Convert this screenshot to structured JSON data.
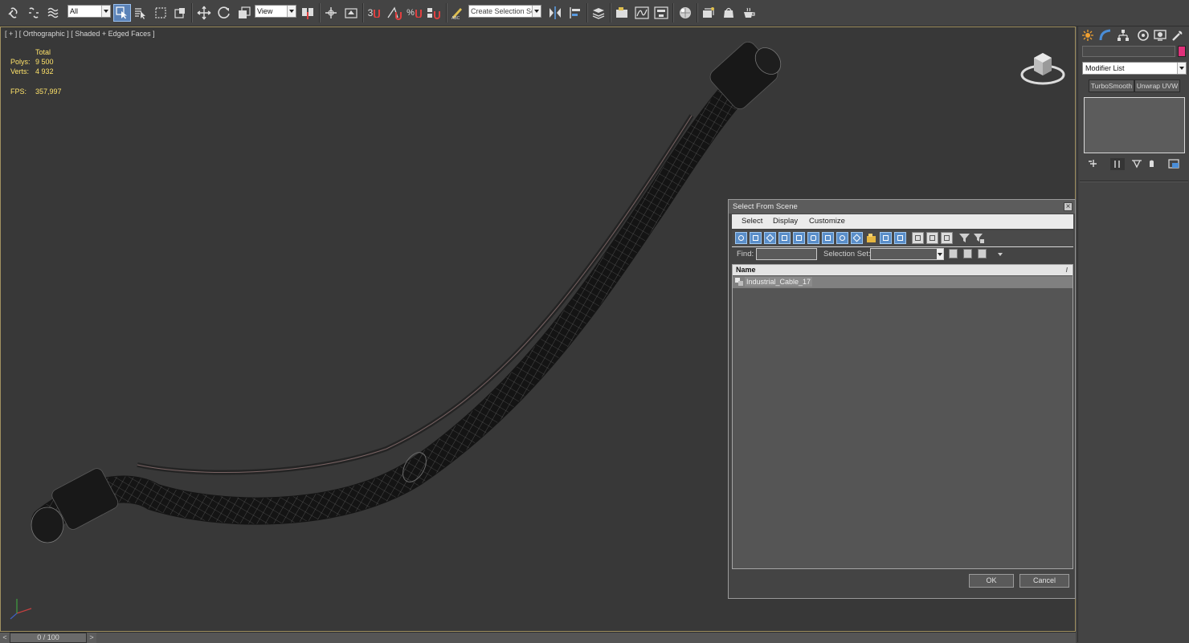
{
  "toolbar": {
    "filter_select": "All",
    "coord_select": "View",
    "snap_3d_label": "3",
    "snap_angle_label": "%",
    "named_selection_set": "Create Selection Se"
  },
  "viewport": {
    "label": "[ + ] [ Orthographic ] [ Shaded + Edged Faces ]",
    "stats": {
      "total_label": "Total",
      "polys_label": "Polys:",
      "polys_value": "9 500",
      "verts_label": "Verts:",
      "verts_value": "4 932",
      "fps_label": "FPS:",
      "fps_value": "357,997"
    }
  },
  "command_panel": {
    "object_name": "",
    "object_color": "#e0317a",
    "modifier_list": "Modifier List",
    "preset_buttons": [
      "TurboSmooth",
      "Unwrap UVW"
    ]
  },
  "dialog": {
    "title": "Select From Scene",
    "close": "×",
    "menus": [
      "Select",
      "Display",
      "Customize"
    ],
    "find_label": "Find:",
    "find_value": "",
    "selection_set_label": "Selection Set:",
    "selection_set_value": "",
    "list_header": "Name",
    "sort_indicator": "/",
    "items": [
      "Industrial_Cable_17"
    ],
    "ok_label": "OK",
    "cancel_label": "Cancel"
  },
  "timeslider": {
    "left_arrow": "<",
    "value": "0 / 100",
    "right_arrow": ">"
  }
}
